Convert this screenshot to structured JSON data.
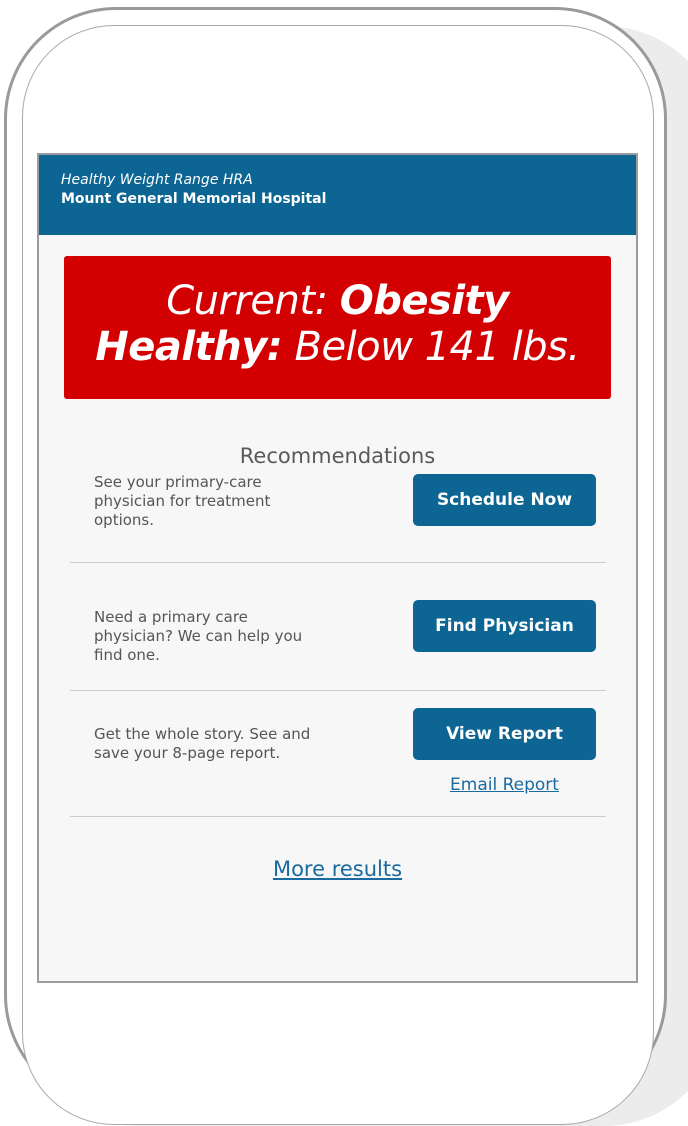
{
  "hra": {
    "subtitle": "Healthy Weight Range HRA",
    "organization": "Mount General Memorial Hospital"
  },
  "result": {
    "current_label": "Current:",
    "current_value": "Obesity",
    "healthy_label": "Healthy:",
    "healthy_value": "Below 141 lbs."
  },
  "recommendations": {
    "title": "Recommendations",
    "items": [
      {
        "text": "See your primary-care physician for treatment options.",
        "button": "Schedule Now"
      },
      {
        "text": "Need a primary care physician? We can help you find one.",
        "button": "Find Physician"
      },
      {
        "text": "Get the whole story. See and save your 8-page report.",
        "button": "View Report",
        "link": "Email Report"
      }
    ]
  },
  "more_results": "More results",
  "colors": {
    "brand_blue": "#0d6593",
    "alert_red": "#d20000",
    "link_blue": "#1a6aa0"
  }
}
